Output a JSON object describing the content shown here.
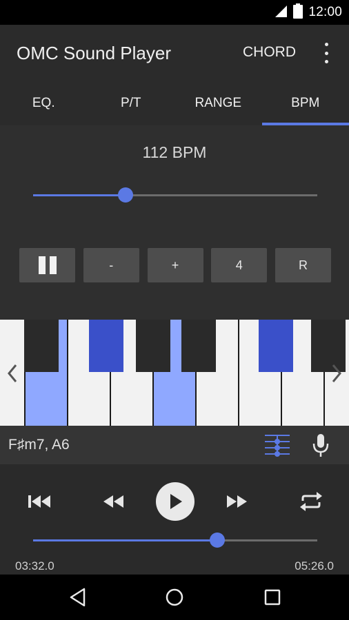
{
  "status_bar": {
    "time": "12:00",
    "icons": [
      "signal-icon",
      "battery-icon"
    ]
  },
  "app_bar": {
    "title": "OMC Sound Player",
    "chord_button": "CHORD",
    "overflow_icon": "more-vert-icon"
  },
  "tabs": [
    {
      "label": "EQ.",
      "active": false
    },
    {
      "label": "P/T",
      "active": false
    },
    {
      "label": "RANGE",
      "active": false
    },
    {
      "label": "BPM",
      "active": true
    }
  ],
  "bpm": {
    "label": "112 BPM",
    "slider_fraction": 0.325,
    "controls": [
      {
        "icon": "pause-icon",
        "label": ""
      },
      {
        "label": "-"
      },
      {
        "label": "+"
      },
      {
        "label": "4"
      },
      {
        "label": "R"
      }
    ]
  },
  "keyboard": {
    "white_keys_highlighted": [
      false,
      true,
      false,
      false,
      true,
      false,
      false,
      false,
      false
    ],
    "black_keys_highlighted": [
      false,
      true,
      false,
      false,
      true,
      false
    ],
    "left_arrow_icon": "chevron-left-icon",
    "right_arrow_icon": "chevron-right-icon"
  },
  "chord_bar": {
    "text": "F♯m7, A6",
    "align_icon": "align-icon",
    "mic_icon": "mic-icon"
  },
  "player": {
    "progress_fraction": 0.649,
    "current_time": "03:32.0",
    "total_time": "05:26.0",
    "icons": [
      "skip-previous-icon",
      "rewind-icon",
      "play-icon",
      "fast-forward-icon",
      "repeat-icon"
    ]
  },
  "navigation": {
    "icons": [
      "back-icon",
      "home-icon",
      "recents-icon"
    ]
  },
  "colors": {
    "accent": "#5b79e4",
    "highlight_white_key": "#8fa8ff",
    "highlight_black_key": "#3a50c9"
  }
}
